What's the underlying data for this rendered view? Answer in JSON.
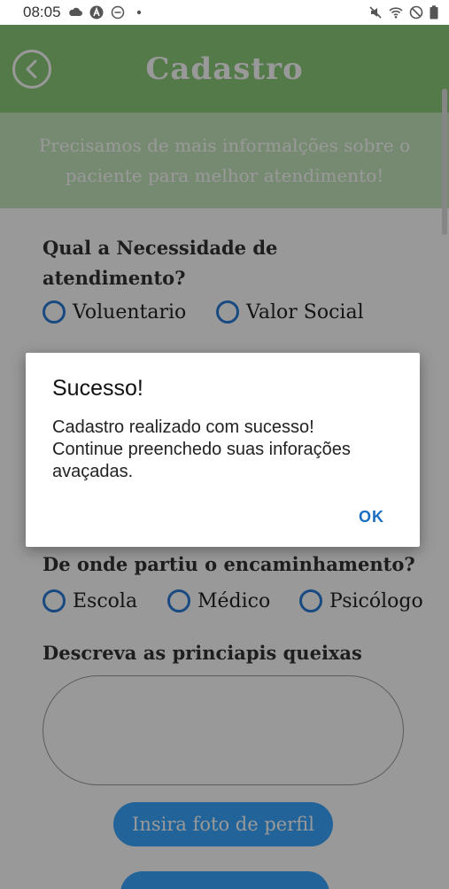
{
  "status_bar": {
    "time": "08:05",
    "icons_left": [
      "cloud-icon",
      "a-badge-icon",
      "minus-circle-icon",
      "dot-icon"
    ],
    "icons_right": [
      "mute-icon",
      "wifi-icon",
      "dnd-icon",
      "battery-icon"
    ]
  },
  "header": {
    "title": "Cadastro",
    "back_icon": "chevron-left-icon",
    "subtitle": "Precisamos de mais informalções sobre o paciente para melhor atendimento!",
    "background_color": "#8bcb79"
  },
  "form": {
    "q1": {
      "label": "Qual a Necessidade de atendimento?",
      "options": [
        "Voluentario",
        "Valor Social"
      ]
    },
    "q2": {
      "label": "De onde partiu o encaminhamento?",
      "options": [
        "Escola",
        "Médico",
        "Psicólogo"
      ]
    },
    "q3": {
      "label": "Descreva as princiapis queixas",
      "value": ""
    },
    "photo_button": "Insira foto de perfil"
  },
  "dialog": {
    "title": "Sucesso!",
    "message": "Cadastro realizado com sucesso!\nContinue preenchedo suas inforações avaçadas.",
    "ok_label": "OK"
  }
}
